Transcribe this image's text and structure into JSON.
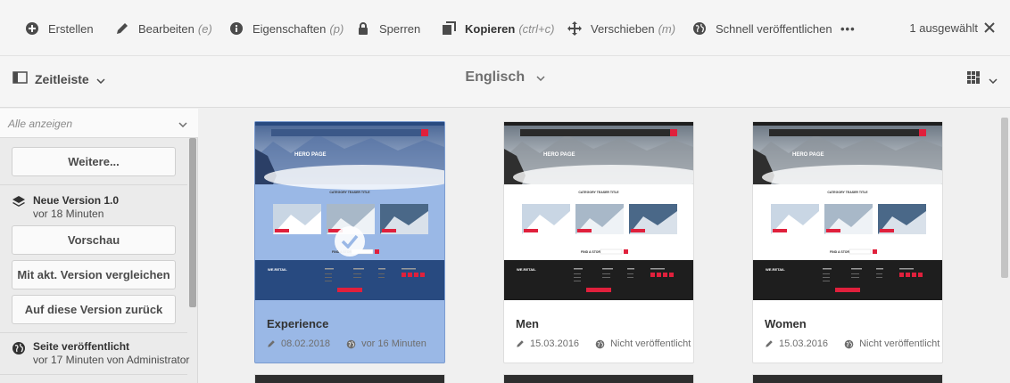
{
  "actionbar": {
    "items": [
      {
        "label": "Erstellen",
        "shortcut": "",
        "icon": "plus-circle-icon"
      },
      {
        "label": "Bearbeiten",
        "shortcut": "(e)",
        "icon": "pencil-icon"
      },
      {
        "label": "Eigenschaften",
        "shortcut": "(p)",
        "icon": "info-icon"
      },
      {
        "label": "Sperren",
        "shortcut": "",
        "icon": "lock-icon"
      },
      {
        "label": "Kopieren",
        "shortcut": "(ctrl+c)",
        "icon": "copy-icon"
      },
      {
        "label": "Verschieben",
        "shortcut": "(m)",
        "icon": "move-icon"
      },
      {
        "label": "Schnell veröffentlichen",
        "shortcut": "",
        "icon": "globe-icon"
      }
    ],
    "more_label": "•••",
    "selection_count": "1 ausgewählt"
  },
  "header": {
    "rail_label": "Zeitleiste",
    "title": "Englisch"
  },
  "rail": {
    "filter_placeholder": "Alle anzeigen",
    "more_button": "Weitere...",
    "version": {
      "title": "Neue Version 1.0",
      "time": "vor 18 Minuten"
    },
    "buttons": [
      "Vorschau",
      "Mit akt. Version vergleichen",
      "Auf diese Version zurück"
    ],
    "published": {
      "title": "Seite veröffentlicht",
      "detail": "vor 17 Minuten von Administrator"
    }
  },
  "cards": [
    {
      "name": "Experience",
      "date": "08.02.2018",
      "status": "vor 16 Minuten",
      "selected": true
    },
    {
      "name": "Men",
      "date": "15.03.2016",
      "status": "Nicht veröffentlicht",
      "selected": false
    },
    {
      "name": "Women",
      "date": "15.03.2016",
      "status": "Nicht veröffentlicht",
      "selected": false
    }
  ],
  "thumbnail": {
    "hero_title": "HERO PAGE",
    "category_title": "CATEGORY TEASER TITLE",
    "story_label": "FIND A STORY",
    "brand": "WE.RETAIL"
  },
  "colors": {
    "selected_card": "#9ab8e6",
    "accent": "#e0203c"
  }
}
